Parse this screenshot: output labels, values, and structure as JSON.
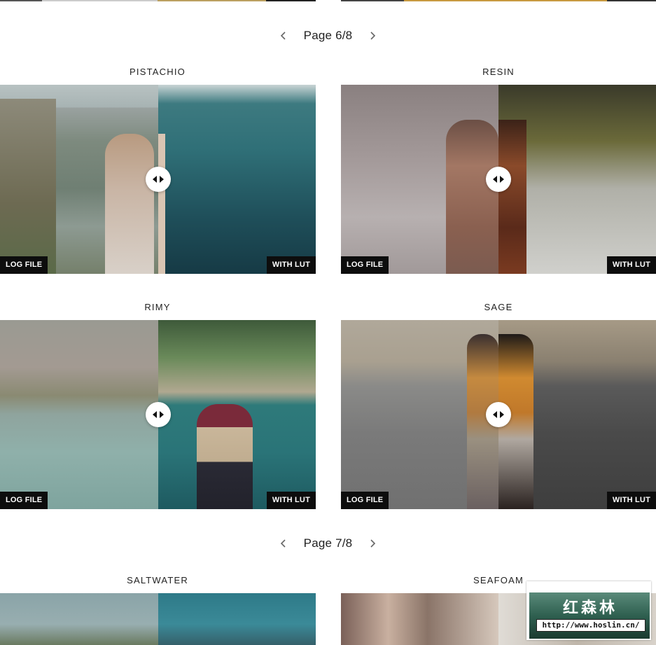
{
  "pagers": [
    {
      "label": "Page 6/8"
    },
    {
      "label": "Page 7/8"
    }
  ],
  "cards": [
    {
      "title": "PISTACHIO",
      "before_label": "LOG FILE",
      "after_label": "WITH LUT"
    },
    {
      "title": "RESIN",
      "before_label": "LOG FILE",
      "after_label": "WITH LUT"
    },
    {
      "title": "RIMY",
      "before_label": "LOG FILE",
      "after_label": "WITH LUT"
    },
    {
      "title": "SAGE",
      "before_label": "LOG FILE",
      "after_label": "WITH LUT"
    },
    {
      "title": "SALTWATER"
    },
    {
      "title": "SEAFOAM"
    }
  ],
  "watermark": {
    "title": "红森林",
    "url": "http://www.hoslin.cn/"
  }
}
